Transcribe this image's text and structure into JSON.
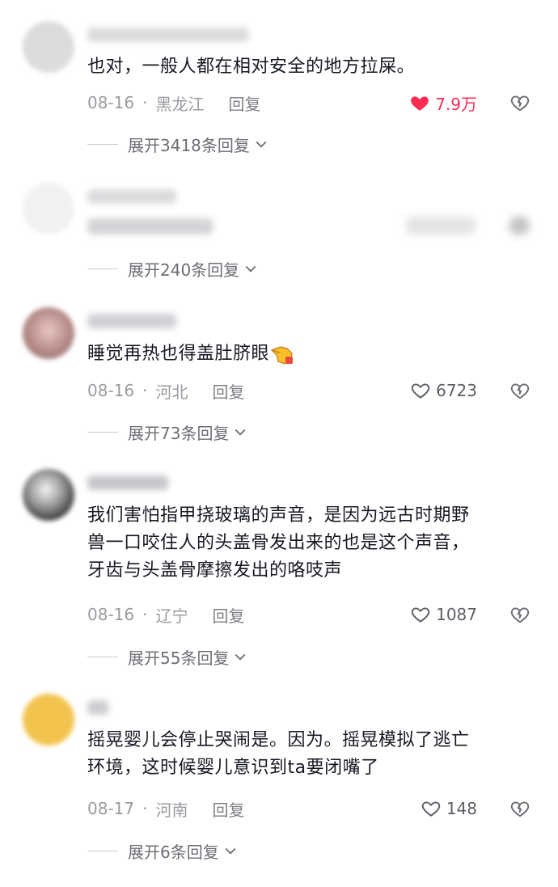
{
  "comments": [
    {
      "text": "也对，一般人都在相对安全的地方拉屎。",
      "date": "08-16",
      "location": "黑龙江",
      "reply_label": "回复",
      "likes": "7.9万",
      "liked": true,
      "expand": "展开3418条回复"
    },
    {
      "expand": "展开240条回复"
    },
    {
      "text": "睡觉再热也得盖肚脐眼",
      "date": "08-16",
      "location": "河北",
      "reply_label": "回复",
      "likes": "6723",
      "expand": "展开73条回复"
    },
    {
      "text_lines": [
        "我们害怕指甲挠玻璃的声音，是因为远古时期野",
        "兽一口咬住人的头盖骨发出来的也是这个声音，",
        "牙齿与头盖骨摩擦发出的咯吱声"
      ],
      "date": "08-16",
      "location": "辽宁",
      "reply_label": "回复",
      "likes": "1087",
      "expand": "展开55条回复"
    },
    {
      "text_lines": [
        "摇晃婴儿会停止哭闹是。因为。摇晃模拟了逃亡",
        "环境，这时候婴儿意识到ta要闭嘴了"
      ],
      "date": "08-17",
      "location": "河南",
      "reply_label": "回复",
      "likes": "148",
      "expand": "展开6条回复"
    }
  ],
  "colors": {
    "accent": "#fe2c55",
    "meta": "#9a9ba1"
  },
  "icons": [
    "heart-icon",
    "heart-outline-icon",
    "broken-heart-icon",
    "chevron-down-icon",
    "pointing-hand-emoji"
  ]
}
